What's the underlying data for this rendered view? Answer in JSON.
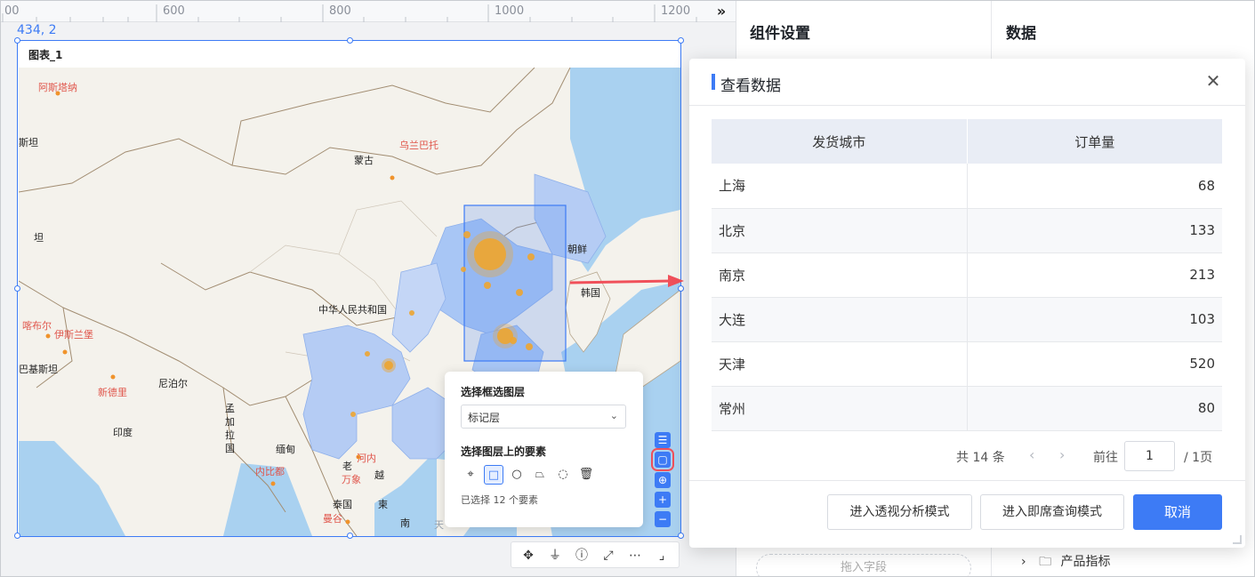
{
  "ruler": {
    "labels": [
      "00",
      "600",
      "800",
      "1000",
      "1200"
    ],
    "collapse_icon": "»"
  },
  "canvas": {
    "coord_readout": "434, 2"
  },
  "chart": {
    "title": "图表_1",
    "map_labels": {
      "astana": "阿斯塔纳",
      "kazakh": "斯坦",
      "ulaanbaatar": "乌兰巴托",
      "mongolia": "蒙古",
      "tan": "坦",
      "north_korea": "朝鲜",
      "korea": "韩国",
      "china": "中华人民共和国",
      "kabul": "喀布尔",
      "islamabad": "伊斯兰堡",
      "pakistan": "巴基斯坦",
      "new_delhi": "新德里",
      "nepal": "尼泊尔",
      "india": "印度",
      "bangladesh": "孟\n加\n拉\n国",
      "myanmar": "缅甸",
      "naypyidaw": "内比都",
      "laos": "老",
      "vientiane": "万象",
      "hanoi": "河内",
      "thailand": "泰国",
      "bangkok": "曼谷",
      "vietnam": "越",
      "cambodia": "柬",
      "nan": "南",
      "tian": "天"
    }
  },
  "select_panel": {
    "layer_title": "选择框选图层",
    "layer_value": "标记层",
    "element_title": "选择图层上的要素",
    "selected_count": "已选择 12 个要素",
    "tools": [
      "point-select-icon",
      "rect-select-icon",
      "circle-select-icon",
      "polygon-select-icon",
      "lasso-select-icon",
      "trash-icon"
    ]
  },
  "map_tools": [
    "legend-icon",
    "box-select-icon",
    "locate-icon",
    "zoom-in-icon",
    "zoom-out-icon"
  ],
  "chart_toolbar": [
    "move-icon",
    "filter-icon",
    "info-icon",
    "expand-icon",
    "more-icon",
    "fit-icon"
  ],
  "side": {
    "component_settings": "组件设置",
    "data": "数据",
    "drop_field": "拖入字段",
    "tree_item": "产品指标"
  },
  "modal": {
    "title": "查看数据",
    "columns": [
      "发货城市",
      "订单量"
    ],
    "rows": [
      {
        "city": "上海",
        "value": "68"
      },
      {
        "city": "北京",
        "value": "133"
      },
      {
        "city": "南京",
        "value": "213"
      },
      {
        "city": "大连",
        "value": "103"
      },
      {
        "city": "天津",
        "value": "520"
      },
      {
        "city": "常州",
        "value": "80"
      }
    ],
    "pager": {
      "total": "共 14 条",
      "goto": "前往",
      "page": "1",
      "pages": "/ 1页"
    },
    "buttons": {
      "pivot": "进入透视分析模式",
      "adhoc": "进入即席查询模式",
      "cancel": "取消"
    }
  },
  "colors": {
    "accent": "#3d7bf5",
    "highlight_region": "#9ec3f5",
    "marker": "#eda531",
    "arrow": "#f0505a"
  }
}
